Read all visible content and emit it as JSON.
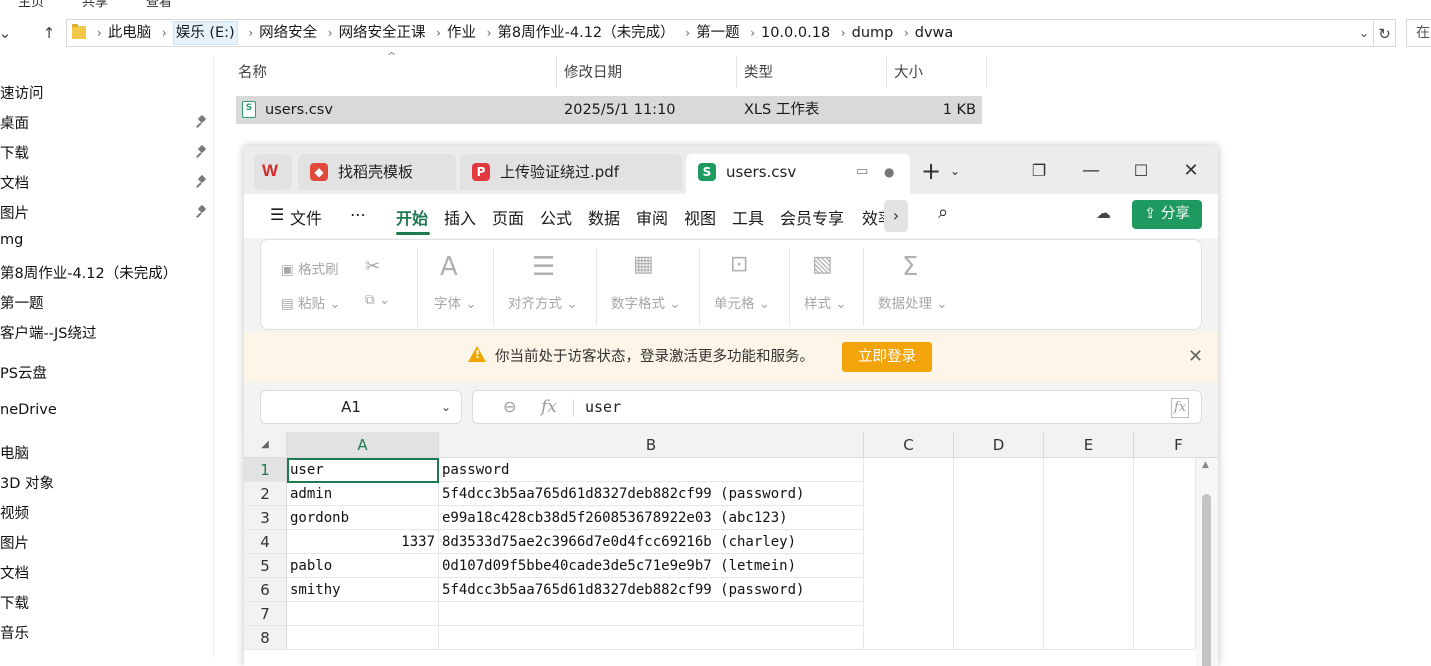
{
  "explorer": {
    "top_menu": [
      "主页",
      "共享",
      "查看"
    ],
    "breadcrumb": [
      "此电脑",
      "娱乐 (E:)",
      "网络安全",
      "网络安全正课",
      "作业",
      "第8周作业-4.12（未完成）",
      "第一题",
      "10.0.0.18",
      "dump",
      "dvwa"
    ],
    "search_placeholder": "在",
    "columns": {
      "name": "名称",
      "modified": "修改日期",
      "type": "类型",
      "size": "大小"
    },
    "file": {
      "name": "users.csv",
      "modified": "2025/5/1 11:10",
      "type": "XLS 工作表",
      "size": "1 KB"
    },
    "nav_items": [
      "速访问",
      "桌面",
      "下载",
      "文档",
      "图片",
      "mg",
      "第8周作业-4.12（未完成）",
      "第一题",
      "客户端--JS绕过",
      "PS云盘",
      "neDrive",
      "电脑",
      "3D 对象",
      "视频",
      "图片",
      "文档",
      "下载",
      "音乐"
    ]
  },
  "wps": {
    "tabs": [
      {
        "label": "找稻壳模板",
        "icon": "daoke-icon"
      },
      {
        "label": "上传验证绕过.pdf",
        "icon": "pdf-icon"
      },
      {
        "label": "users.csv",
        "icon": "sheet-icon"
      }
    ],
    "menu": [
      "文件",
      "开始",
      "插入",
      "页面",
      "公式",
      "数据",
      "审阅",
      "视图",
      "工具",
      "会员专享",
      "效率"
    ],
    "share_label": "分享",
    "ribbon": {
      "format_painter": "格式刷",
      "paste": "粘贴",
      "font": "字体",
      "align": "对齐方式",
      "number": "数字格式",
      "cell": "单元格",
      "style": "样式",
      "data": "数据处理"
    },
    "notice": {
      "text": "你当前处于访客状态，登录激活更多功能和服务。",
      "button": "立即登录"
    },
    "name_box": "A1",
    "formula_value": "user",
    "columns": [
      "A",
      "B",
      "C",
      "D",
      "E",
      "F"
    ],
    "rows": [
      {
        "num": "1",
        "a": "user",
        "b": "password"
      },
      {
        "num": "2",
        "a": "admin",
        "b": "5f4dcc3b5aa765d61d8327deb882cf99 (password)"
      },
      {
        "num": "3",
        "a": "gordonb",
        "b": "e99a18c428cb38d5f260853678922e03 (abc123)"
      },
      {
        "num": "4",
        "a": "1337",
        "b": "8d3533d75ae2c3966d7e0d4fcc69216b (charley)"
      },
      {
        "num": "5",
        "a": "pablo",
        "b": "0d107d09f5bbe40cade3de5c71e9e9b7 (letmein)"
      },
      {
        "num": "6",
        "a": "smithy",
        "b": "5f4dcc3b5aa765d61d8327deb882cf99 (password)"
      },
      {
        "num": "7",
        "a": "",
        "b": ""
      },
      {
        "num": "8",
        "a": "",
        "b": ""
      }
    ]
  }
}
